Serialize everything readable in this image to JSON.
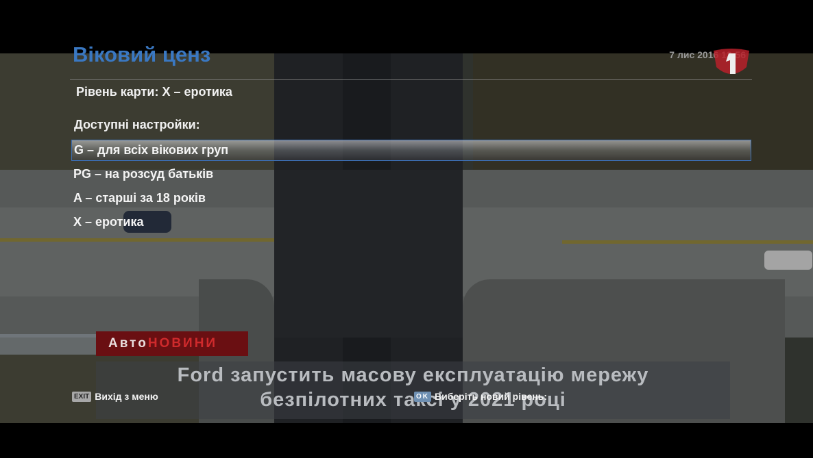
{
  "header": {
    "title": "Віковий ценз",
    "datetime": "7 лис 2016 13:56"
  },
  "card_level": "Рівень карти:  X – еротика",
  "available_label": "Доступні настройки:",
  "options": [
    {
      "label": "G – для всіх вікових груп",
      "selected": true
    },
    {
      "label": "PG – на розсуд батьків",
      "selected": false
    },
    {
      "label": "A – старші за 18 років",
      "selected": false
    },
    {
      "label": "X – еротика",
      "selected": false
    }
  ],
  "news": {
    "badge_part1": "Авто",
    "badge_part2": "НОВИНИ",
    "line1": "Ford запустить масову експлуатацію мережу",
    "line2": "безпілотних таксі у 2021 році"
  },
  "footer": {
    "exit_key": "EXIT",
    "exit_label": "Вихід з меню",
    "ok_key": "OK",
    "ok_label": "Виберіть новий рівень:"
  },
  "colors": {
    "title": "#3a78c2",
    "selection_border": "#3c6fb4",
    "news_badge_bg": "#6a0f12",
    "news_badge_accent": "#cf2a2c",
    "channel_logo": "#b8202a"
  },
  "icons": {
    "channel_logo": "channel-1-logo"
  }
}
